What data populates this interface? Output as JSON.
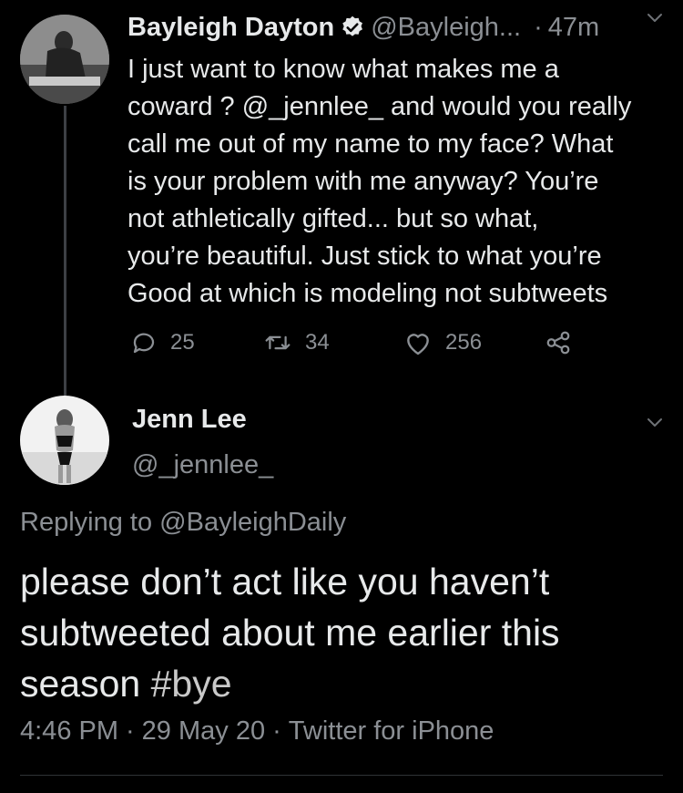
{
  "tweet1": {
    "name": "Bayleigh Dayton",
    "handle": "@Bayleigh...",
    "time_sep": "·",
    "time": "47m",
    "text": "I just want to know what makes me a\ncoward ? @_jennlee_ and would you really\ncall me out of my name to my face? What\nis your problem with me anyway? You’re\nnot athletically gifted... but so what,\nyou’re beautiful. Just stick to what you’re\nGood at which is modeling not subtweets",
    "reply_count": "25",
    "retweet_count": "34",
    "like_count": "256"
  },
  "tweet2": {
    "name": "Jenn Lee",
    "handle": "@_jennlee_",
    "replying_prefix": "Replying to",
    "replying_handle": "@BayleighDaily",
    "text_main": "please don’t act like you haven’t subtweeted about me earlier this season",
    "hashtag": "#bye",
    "meta_time": "4:46 PM",
    "meta_sep": "·",
    "meta_date": "29 May 20",
    "meta_sep2": "·",
    "meta_client": "Twitter for iPhone"
  },
  "icons": {
    "verified": "verified-badge-icon",
    "caret": "chevron-down-icon",
    "reply": "reply-icon",
    "retweet": "retweet-icon",
    "like": "heart-icon",
    "share": "share-icon"
  },
  "colors": {
    "background": "#000000",
    "text": "#e7e9ea",
    "secondary": "#8b8f94",
    "thread_line": "#3d4045"
  }
}
